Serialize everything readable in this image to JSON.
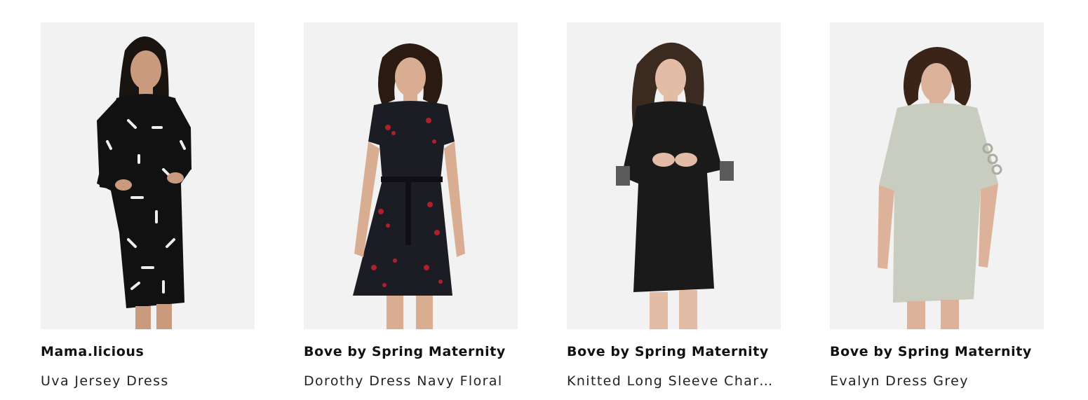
{
  "products": [
    {
      "brand": "Mama.licious",
      "name": "Uva Jersey Dress",
      "image_alt": "model-wearing-black-patterned-long-sleeve-dress"
    },
    {
      "brand": "Bove by Spring Maternity",
      "name": "Dorothy Dress Navy Floral",
      "image_alt": "model-wearing-navy-floral-short-sleeve-dress"
    },
    {
      "brand": "Bove by Spring Maternity",
      "name": "Knitted Long Sleeve Charn...",
      "image_alt": "model-wearing-black-knitted-dress"
    },
    {
      "brand": "Bove by Spring Maternity",
      "name": "Evalyn Dress Grey",
      "image_alt": "model-wearing-grey-dress-with-lace-sleeves"
    }
  ],
  "colors": {
    "photo_background": "#f2f2f2",
    "dress_1": "#111111",
    "dress_2": "#1c1c24",
    "dress_3": "#1a1a1a",
    "dress_4": "#c9cdbf",
    "floral_accent": "#b0202a"
  }
}
